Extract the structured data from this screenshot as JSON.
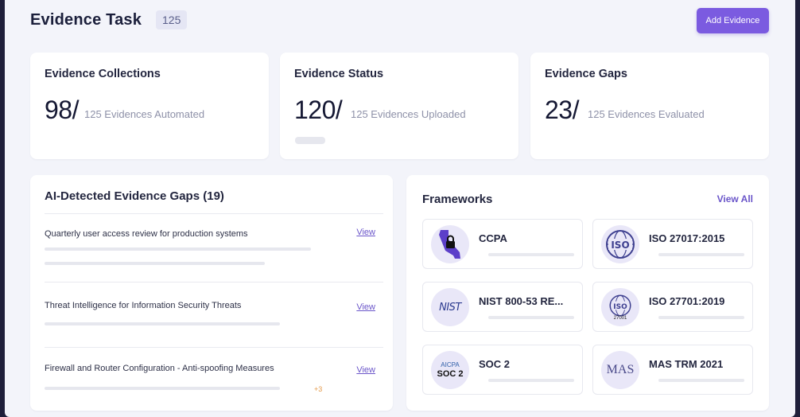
{
  "header": {
    "title": "Evidence Task",
    "count": "125",
    "add_button": "Add Evidence"
  },
  "stats": [
    {
      "title": "Evidence Collections",
      "value": "98/",
      "sub": "125 Evidences Automated"
    },
    {
      "title": "Evidence Status",
      "value": "120/",
      "sub": "125 Evidences Uploaded"
    },
    {
      "title": "Evidence Gaps",
      "value": "23/",
      "sub": "125 Evidences Evaluated"
    }
  ],
  "gaps": {
    "title": "AI-Detected Evidence Gaps (19)",
    "items": [
      {
        "text": "Quarterly user access review for production systems",
        "action": "View"
      },
      {
        "text": "Threat Intelligence for Information Security Threats",
        "action": "View"
      },
      {
        "text": "Firewall and Router Configuration - Anti-spoofing Measures",
        "action": "View",
        "more": "+3"
      }
    ]
  },
  "frameworks": {
    "title": "Frameworks",
    "view_all": "View All",
    "items": [
      {
        "name": "CCPA",
        "icon": "california-lock-icon"
      },
      {
        "name": "ISO 27017:2015",
        "icon": "iso-logo-icon"
      },
      {
        "name": "NIST 800-53 RE...",
        "icon": "nist-logo-icon",
        "logo_text": "NIST"
      },
      {
        "name": "ISO 27701:2019",
        "icon": "iso-27701-logo-icon",
        "logo_sub": "27001"
      },
      {
        "name": "SOC 2",
        "icon": "aicpa-soc2-logo-icon",
        "logo_top": "AICPA",
        "logo_main": "SOC 2"
      },
      {
        "name": "MAS TRM 2021",
        "icon": "mas-logo-icon",
        "logo_text": "MAS"
      }
    ]
  },
  "colors": {
    "accent": "#7b5be0",
    "link": "#6a55c9",
    "page_bg": "#f3f4fa",
    "more_badge": "#e49a4a"
  }
}
